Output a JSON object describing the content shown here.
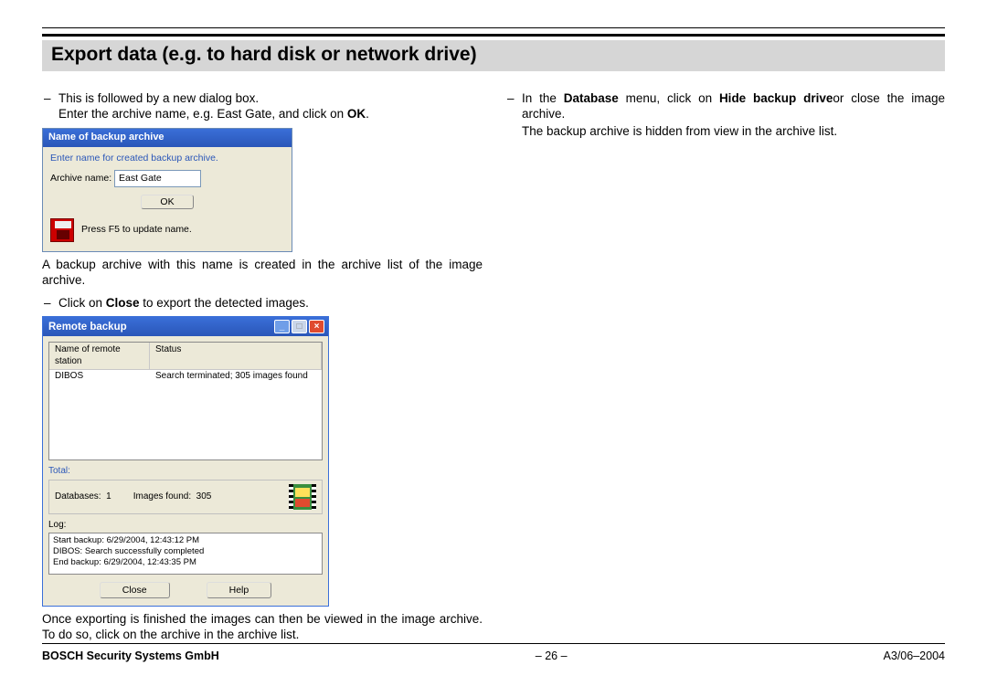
{
  "header": {
    "title": "Export data (e.g. to hard disk or network drive)"
  },
  "left": {
    "b1_line1": "This is followed by a new dialog box.",
    "b1_line2_pre": "Enter the archive name, e.g. East Gate, and click on ",
    "b1_line2_bold": "OK",
    "b1_line2_post": ".",
    "dlg1": {
      "title": "Name of backup archive",
      "prompt": "Enter name for created backup archive.",
      "label": "Archive name:",
      "value": "East Gate",
      "ok": "OK",
      "hint": "Press F5 to update name."
    },
    "after1": "A backup archive with this name is created in the archive list of the image archive.",
    "b2_pre": "Click on ",
    "b2_bold": "Close",
    "b2_post": " to export the detected images.",
    "dlg2": {
      "title": "Remote backup",
      "col1": "Name of remote station",
      "col2": "Status",
      "row_station": "DIBOS",
      "row_status": "Search terminated; 305 images found",
      "total_label": "Total:",
      "databases_label": "Databases:",
      "databases_value": "1",
      "images_label": "Images found:",
      "images_value": "305",
      "log_label": "Log:",
      "log1": "Start backup: 6/29/2004, 12:43:12 PM",
      "log2": "DIBOS: Search successfully completed",
      "log3": "End backup: 6/29/2004, 12:43:35 PM",
      "close": "Close",
      "help": "Help"
    },
    "after2": "Once exporting is finished the images can then be viewed in the image archive. To do so, click on the archive in the archive list."
  },
  "right": {
    "b1_pre": "In the ",
    "b1_bold1": "Database",
    "b1_mid": " menu, click on ",
    "b1_bold2": "Hide backup drive",
    "b1_post": "or close the image archive.",
    "line2": "The backup archive is hidden from view in the archive list."
  },
  "footer": {
    "left": "BOSCH Security Systems GmbH",
    "center": "– 26 –",
    "right": "A3/06–2004"
  }
}
